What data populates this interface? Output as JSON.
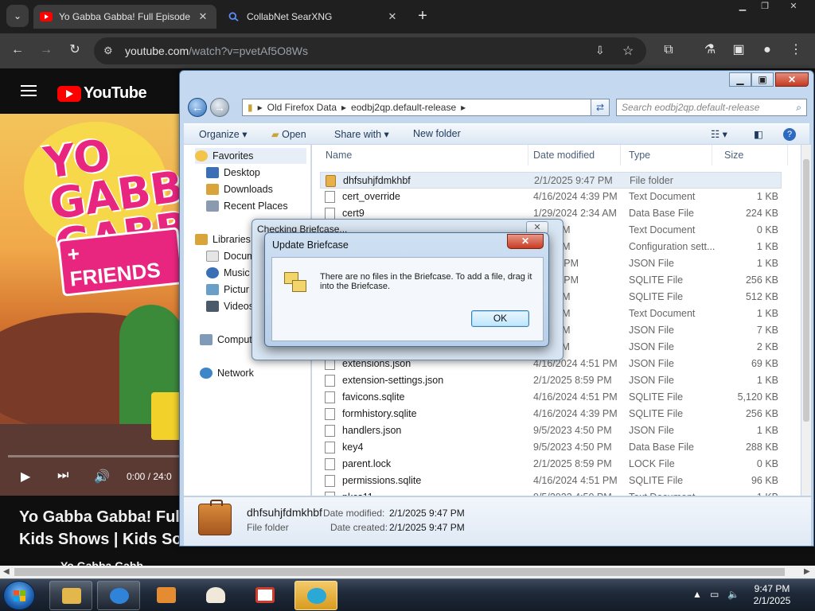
{
  "browser": {
    "tabs": [
      {
        "title": "Yo Gabba Gabba! Full Episode",
        "active": true
      },
      {
        "title": "CollabNet SearXNG",
        "active": false
      }
    ],
    "url_host": "youtube.com",
    "url_path": "/watch?v=pvetAf5O8Ws"
  },
  "youtube": {
    "logo": "YouTube",
    "video_overlay": {
      "line1": "YO GABBA",
      "line2": "GABBA",
      "friends": "+ FRIENDS"
    },
    "time": "0:00 / 24:0",
    "title_line1": "Yo Gabba Gabba! Full E",
    "title_line2": "Kids Shows | Kids Son",
    "channel": "Yo Gabba Gabb"
  },
  "explorer": {
    "breadcrumb": [
      "Old Firefox Data",
      "eodbj2qp.default-release"
    ],
    "search_placeholder": "Search eodbj2qp.default-release",
    "commands": {
      "organize": "Organize",
      "open": "Open",
      "share": "Share with",
      "new_folder": "New folder"
    },
    "nav": {
      "favorites": "Favorites",
      "desktop": "Desktop",
      "downloads": "Downloads",
      "recent": "Recent Places",
      "libraries": "Libraries",
      "documents": "Docum",
      "music": "Music",
      "pictures": "Pictur",
      "videos": "Videos",
      "computer": "Comput",
      "network": "Network"
    },
    "columns": {
      "name": "Name",
      "date": "Date modified",
      "type": "Type",
      "size": "Size"
    },
    "files": [
      {
        "name": "dhfsuhjfdmkhbf",
        "date": "2/1/2025 9:47 PM",
        "type": "File folder",
        "size": "",
        "folder": true
      },
      {
        "name": "cert_override",
        "date": "4/16/2024 4:39 PM",
        "type": "Text Document",
        "size": "1 KB"
      },
      {
        "name": "cert9",
        "date": "1/29/2024 2:34 AM",
        "type": "Data Base File",
        "size": "224 KB"
      },
      {
        "name": "",
        "date": "4:39 PM",
        "type": "Text Document",
        "size": "0 KB"
      },
      {
        "name": "",
        "date": "4:51 PM",
        "type": "Configuration sett...",
        "size": "1 KB"
      },
      {
        "name": "",
        "date": "3 4:50 PM",
        "type": "JSON File",
        "size": "1 KB"
      },
      {
        "name": "",
        "date": "5 8:59 PM",
        "type": "SQLITE File",
        "size": "256 KB"
      },
      {
        "name": "",
        "date": "4:51 PM",
        "type": "SQLITE File",
        "size": "512 KB"
      },
      {
        "name": "",
        "date": "4:39 PM",
        "type": "Text Document",
        "size": "1 KB"
      },
      {
        "name": "",
        "date": "4:51 PM",
        "type": "JSON File",
        "size": "7 KB"
      },
      {
        "name": "",
        "date": "2:34 AM",
        "type": "JSON File",
        "size": "2 KB"
      },
      {
        "name": "extensions.json",
        "date": "4/16/2024 4:51 PM",
        "type": "JSON File",
        "size": "69 KB"
      },
      {
        "name": "extension-settings.json",
        "date": "2/1/2025 8:59 PM",
        "type": "JSON File",
        "size": "1 KB"
      },
      {
        "name": "favicons.sqlite",
        "date": "4/16/2024 4:51 PM",
        "type": "SQLITE File",
        "size": "5,120 KB"
      },
      {
        "name": "formhistory.sqlite",
        "date": "4/16/2024 4:39 PM",
        "type": "SQLITE File",
        "size": "256 KB"
      },
      {
        "name": "handlers.json",
        "date": "9/5/2023 4:50 PM",
        "type": "JSON File",
        "size": "1 KB"
      },
      {
        "name": "key4",
        "date": "9/5/2023 4:50 PM",
        "type": "Data Base File",
        "size": "288 KB"
      },
      {
        "name": "parent.lock",
        "date": "2/1/2025 8:59 PM",
        "type": "LOCK File",
        "size": "0 KB"
      },
      {
        "name": "permissions.sqlite",
        "date": "4/16/2024 4:51 PM",
        "type": "SQLITE File",
        "size": "96 KB"
      },
      {
        "name": "pkcs11",
        "date": "9/5/2023 4:50 PM",
        "type": "Text Document",
        "size": "1 KB"
      }
    ],
    "details": {
      "name": "dhfsuhjfdmkhbf",
      "kind": "File folder",
      "modified_label": "Date modified:",
      "modified": "2/1/2025 9:47 PM",
      "created_label": "Date created:",
      "created": "2/1/2025 9:47 PM"
    }
  },
  "checking_dialog": {
    "title": "Checking Briefcase..."
  },
  "update_dialog": {
    "title": "Update Briefcase",
    "message": "There are no files in the Briefcase. To add a file, drag it into the Briefcase.",
    "ok": "OK"
  },
  "taskbar": {
    "time": "9:47 PM",
    "date": "2/1/2025"
  }
}
